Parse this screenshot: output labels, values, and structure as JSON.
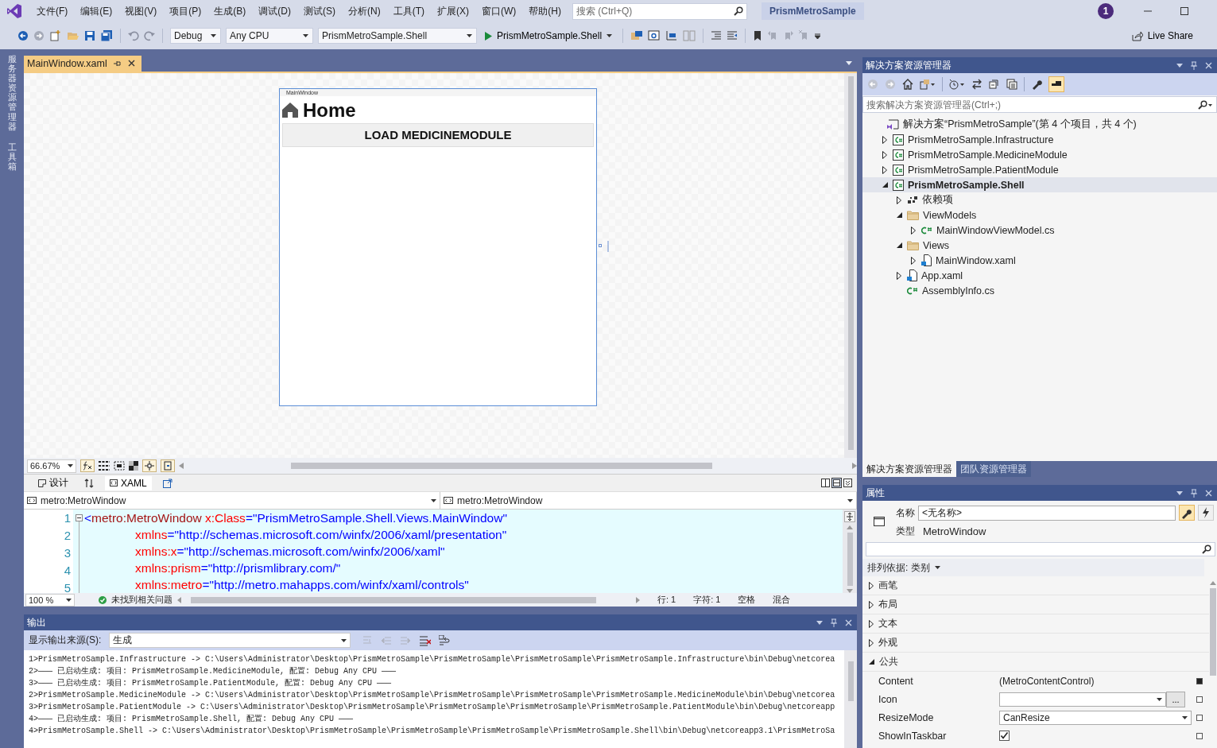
{
  "menu": [
    {
      "label": "文件(F)"
    },
    {
      "label": "编辑(E)"
    },
    {
      "label": "视图(V)"
    },
    {
      "label": "项目(P)"
    },
    {
      "label": "生成(B)"
    },
    {
      "label": "调试(D)"
    },
    {
      "label": "测试(S)"
    },
    {
      "label": "分析(N)"
    },
    {
      "label": "工具(T)"
    },
    {
      "label": "扩展(X)"
    },
    {
      "label": "窗口(W)"
    },
    {
      "label": "帮助(H)"
    }
  ],
  "search": {
    "placeholder": "搜索 (Ctrl+Q)"
  },
  "solution_name": "PrismMetroSample",
  "notification_count": "1",
  "toolbar": {
    "configuration": "Debug",
    "platform": "Any CPU",
    "startup_project": "PrismMetroSample.Shell",
    "run_label": "PrismMetroSample.Shell",
    "live_share": "Live Share"
  },
  "side_tabs": [
    "服务器资源管理器",
    "工具箱"
  ],
  "document_tabs": [
    {
      "label": "MainWindow.xaml",
      "selected": true
    }
  ],
  "designer": {
    "window_title": "MainWindow",
    "heading": "Home",
    "button": "LOAD MEDICINEMODULE",
    "zoom": "66.67%"
  },
  "view_tabs": [
    {
      "label": "设计",
      "selected": false
    },
    {
      "label": "XAML",
      "selected": true
    }
  ],
  "navigation": [
    "metro:MetroWindow",
    "metro:MetroWindow"
  ],
  "code_lines": [
    {
      "number": "1",
      "tokens": [
        {
          "kind": "punct",
          "text": "<"
        },
        {
          "kind": "tag",
          "text": "metro:MetroWindow"
        },
        {
          "kind": "attr",
          "text": " x:Class"
        },
        {
          "kind": "punct",
          "text": "="
        },
        {
          "kind": "value",
          "text": "\"PrismMetroSample.Shell.Views.MainWindow\""
        }
      ]
    },
    {
      "number": "2",
      "tokens": [
        {
          "kind": "attr",
          "text": "xmlns"
        },
        {
          "kind": "punct",
          "text": "="
        },
        {
          "kind": "value",
          "text": "\"http://schemas.microsoft.com/winfx/2006/xaml/presentation\""
        }
      ]
    },
    {
      "number": "3",
      "tokens": [
        {
          "kind": "attr",
          "text": "xmlns:x"
        },
        {
          "kind": "punct",
          "text": "="
        },
        {
          "kind": "value",
          "text": "\"http://schemas.microsoft.com/winfx/2006/xaml\""
        }
      ]
    },
    {
      "number": "4",
      "tokens": [
        {
          "kind": "attr",
          "text": "xmlns:prism"
        },
        {
          "kind": "punct",
          "text": "="
        },
        {
          "kind": "value",
          "text": "\"http://prismlibrary.com/\""
        }
      ]
    },
    {
      "number": "5",
      "tokens": [
        {
          "kind": "attr",
          "text": "xmlns:metro"
        },
        {
          "kind": "punct",
          "text": "="
        },
        {
          "kind": "value",
          "text": "\"http://metro.mahapps.com/winfx/xaml/controls\""
        }
      ]
    }
  ],
  "editor_status": {
    "zoom": "100 %",
    "issues": "未找到相关问题",
    "line": "行: 1",
    "char": "字符: 1",
    "spaces": "空格",
    "line_endings": "混合"
  },
  "output": {
    "title": "输出",
    "source_label": "显示输出来源(S):",
    "source": "生成",
    "lines": [
      "1>PrismMetroSample.Infrastructure -> C:\\Users\\Administrator\\Desktop\\PrismMetroSample\\PrismMetroSample\\PrismMetroSample\\PrismMetroSample.Infrastructure\\bin\\Debug\\netcorea",
      "2>——— 已启动生成: 项目: PrismMetroSample.MedicineModule, 配置: Debug Any CPU ———",
      "3>——— 已启动生成: 项目: PrismMetroSample.PatientModule, 配置: Debug Any CPU ———",
      "2>PrismMetroSample.MedicineModule -> C:\\Users\\Administrator\\Desktop\\PrismMetroSample\\PrismMetroSample\\PrismMetroSample\\PrismMetroSample.MedicineModule\\bin\\Debug\\netcorea",
      "3>PrismMetroSample.PatientModule -> C:\\Users\\Administrator\\Desktop\\PrismMetroSample\\PrismMetroSample\\PrismMetroSample\\PrismMetroSample.PatientModule\\bin\\Debug\\netcoreapp",
      "4>——— 已启动生成: 项目: PrismMetroSample.Shell, 配置: Debug Any CPU ———",
      "4>PrismMetroSample.Shell -> C:\\Users\\Administrator\\Desktop\\PrismMetroSample\\PrismMetroSample\\PrismMetroSample\\PrismMetroSample.Shell\\bin\\Debug\\netcoreapp3.1\\PrismMetroSa"
    ]
  },
  "solution_explorer": {
    "title": "解决方案资源管理器",
    "search_placeholder": "搜索解决方案资源管理器(Ctrl+;)",
    "tree": [
      {
        "label": "解决方案“PrismMetroSample”(第 4 个项目，共 4 个)",
        "kind": "solution",
        "selected": false,
        "children": [
          {
            "label": "PrismMetroSample.Infrastructure",
            "kind": "csproj",
            "expandable": true,
            "expanded": false,
            "selected": false
          },
          {
            "label": "PrismMetroSample.MedicineModule",
            "kind": "csproj",
            "expandable": true,
            "expanded": false,
            "selected": false
          },
          {
            "label": "PrismMetroSample.PatientModule",
            "kind": "csproj",
            "expandable": true,
            "expanded": false,
            "selected": false
          },
          {
            "label": "PrismMetroSample.Shell",
            "kind": "csproj",
            "expandable": true,
            "expanded": true,
            "selected": true,
            "children": [
              {
                "label": "依赖项",
                "kind": "deps",
                "expandable": true,
                "expanded": false,
                "selected": false
              },
              {
                "label": "ViewModels",
                "kind": "folder",
                "expandable": true,
                "expanded": true,
                "selected": false,
                "children": [
                  {
                    "label": "MainWindowViewModel.cs",
                    "kind": "cs",
                    "expandable": true,
                    "expanded": false,
                    "selected": false
                  }
                ]
              },
              {
                "label": "Views",
                "kind": "folder",
                "expandable": true,
                "expanded": true,
                "selected": false,
                "children": [
                  {
                    "label": "MainWindow.xaml",
                    "kind": "xaml",
                    "expandable": true,
                    "expanded": false,
                    "selected": false
                  }
                ]
              },
              {
                "label": "App.xaml",
                "kind": "xaml",
                "expandable": true,
                "expanded": false,
                "selected": false
              },
              {
                "label": "AssemblyInfo.cs",
                "kind": "cs",
                "expandable": false,
                "selected": false
              }
            ]
          }
        ]
      }
    ],
    "bottom_tabs": [
      {
        "label": "解决方案资源管理器",
        "selected": true
      },
      {
        "label": "团队资源管理器",
        "selected": false
      }
    ]
  },
  "properties": {
    "title": "属性",
    "name_label": "名称",
    "name_value": "<无名称>",
    "type_label": "类型",
    "type_value": "MetroWindow",
    "sort": "排列依据: 类别",
    "categories": [
      {
        "label": "画笔",
        "expanded": false
      },
      {
        "label": "布局",
        "expanded": false
      },
      {
        "label": "文本",
        "expanded": false
      },
      {
        "label": "外观",
        "expanded": false
      },
      {
        "label": "公共",
        "expanded": true,
        "children": [
          {
            "name": "Content",
            "kind": "text",
            "value": "(MetroContentControl)",
            "local": true
          },
          {
            "name": "Icon",
            "kind": "picker",
            "button": "...",
            "local": false
          },
          {
            "name": "ResizeMode",
            "kind": "dropdown",
            "value": "CanResize",
            "local": false
          },
          {
            "name": "ShowInTaskbar",
            "kind": "checkbox",
            "checked": true,
            "local": false
          }
        ]
      }
    ]
  }
}
